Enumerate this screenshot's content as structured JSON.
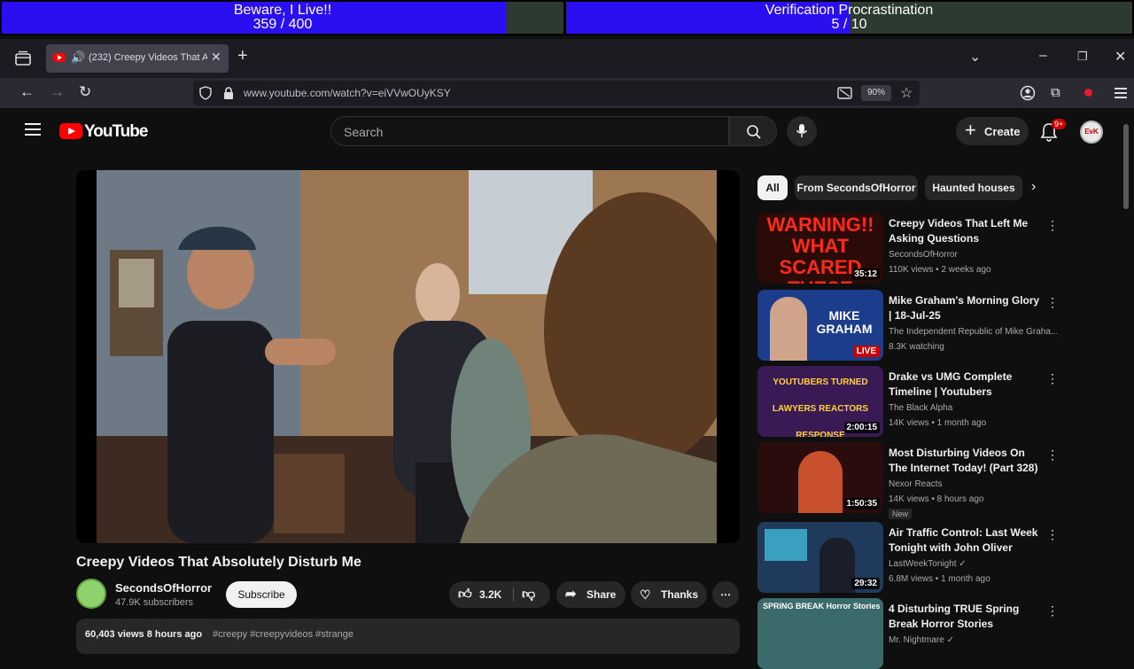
{
  "overlay": {
    "bar1": {
      "title": "Beware, I Live!!",
      "count": "359 / 400",
      "progress": 0.8975
    },
    "bar2": {
      "title": "Verification Procrastination",
      "count": "5 / 10",
      "progress": 0.5
    }
  },
  "browser": {
    "tab_title": "(232) Creepy Videos That A",
    "url": "www.youtube.com/watch?v=eiVVwOUyKSY",
    "zoom": "90%"
  },
  "youtube": {
    "logo": "YouTube",
    "search_placeholder": "Search",
    "create_label": "Create",
    "notification_count": "9+",
    "avatar_text": "EvK"
  },
  "video": {
    "title": "Creepy Videos That Absolutely Disturb Me",
    "channel": "SecondsOfHorror",
    "subscribers": "47.9K subscribers",
    "subscribe_label": "Subscribe",
    "likes": "3.2K",
    "share_label": "Share",
    "thanks_label": "Thanks",
    "views_line": "60,403 views  8 hours ago",
    "tags": "#creepy #creepyvideos #strange"
  },
  "chips": [
    "All",
    "From SecondsOfHorror",
    "Haunted houses"
  ],
  "recommendations": [
    {
      "title": "Creepy Videos That Left Me Asking Questions",
      "channel": "SecondsOfHorror",
      "meta": "110K views • 2 weeks ago",
      "duration": "35:12",
      "thumb_text": "WARNING!! WHAT SCARED THESE PEOPLE?! CAUGHT ON CAMERA!! SOMETHING'S VERY WRONG"
    },
    {
      "title": "Mike Graham's Morning Glory | 18-Jul-25",
      "channel": "The Independent Republic of Mike Graha...",
      "meta": "8.3K watching",
      "live": "LIVE",
      "thumb_text": "MIKE GRAHAM"
    },
    {
      "title": "Drake vs UMG Complete Timeline | Youtubers Practisin...",
      "channel": "The Black Alpha",
      "meta": "14K views • 1 month ago",
      "duration": "2:00:15",
      "thumb_text": "YOUTUBERS TURNED LAWYERS REACTORS RESPONSE"
    },
    {
      "title": "Most Disturbing Videos On The Internet Today! (Part 328)",
      "channel": "Nexor Reacts",
      "meta": "14K views • 8 hours ago",
      "duration": "1:50:35",
      "badge": "New"
    },
    {
      "title": "Air Traffic Control: Last Week Tonight with John Oliver (HBO)",
      "channel": "LastWeekTonight ✓",
      "meta": "6.8M views • 1 month ago",
      "duration": "29:32"
    },
    {
      "title": "4 Disturbing TRUE Spring Break Horror Stories",
      "channel": "Mr. Nightmare ✓",
      "meta": "",
      "thumb_text": "SPRING BREAK Horror Stories"
    }
  ],
  "colors": {
    "progress_fill": "#2a10f0",
    "yt_red": "#ff0000",
    "bg": "#0f0f0f"
  }
}
